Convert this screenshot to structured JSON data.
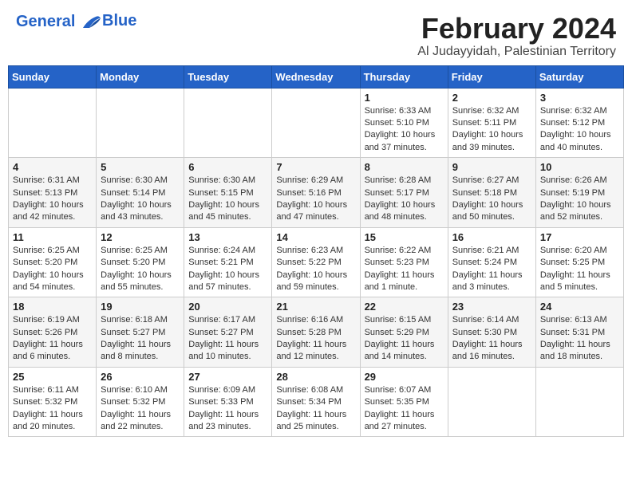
{
  "header": {
    "logo_line1": "General",
    "logo_line2": "Blue",
    "title": "February 2024",
    "subtitle": "Al Judayyidah, Palestinian Territory"
  },
  "days_of_week": [
    "Sunday",
    "Monday",
    "Tuesday",
    "Wednesday",
    "Thursday",
    "Friday",
    "Saturday"
  ],
  "weeks": [
    [
      {
        "day": "",
        "info": ""
      },
      {
        "day": "",
        "info": ""
      },
      {
        "day": "",
        "info": ""
      },
      {
        "day": "",
        "info": ""
      },
      {
        "day": "1",
        "info": "Sunrise: 6:33 AM\nSunset: 5:10 PM\nDaylight: 10 hours\nand 37 minutes."
      },
      {
        "day": "2",
        "info": "Sunrise: 6:32 AM\nSunset: 5:11 PM\nDaylight: 10 hours\nand 39 minutes."
      },
      {
        "day": "3",
        "info": "Sunrise: 6:32 AM\nSunset: 5:12 PM\nDaylight: 10 hours\nand 40 minutes."
      }
    ],
    [
      {
        "day": "4",
        "info": "Sunrise: 6:31 AM\nSunset: 5:13 PM\nDaylight: 10 hours\nand 42 minutes."
      },
      {
        "day": "5",
        "info": "Sunrise: 6:30 AM\nSunset: 5:14 PM\nDaylight: 10 hours\nand 43 minutes."
      },
      {
        "day": "6",
        "info": "Sunrise: 6:30 AM\nSunset: 5:15 PM\nDaylight: 10 hours\nand 45 minutes."
      },
      {
        "day": "7",
        "info": "Sunrise: 6:29 AM\nSunset: 5:16 PM\nDaylight: 10 hours\nand 47 minutes."
      },
      {
        "day": "8",
        "info": "Sunrise: 6:28 AM\nSunset: 5:17 PM\nDaylight: 10 hours\nand 48 minutes."
      },
      {
        "day": "9",
        "info": "Sunrise: 6:27 AM\nSunset: 5:18 PM\nDaylight: 10 hours\nand 50 minutes."
      },
      {
        "day": "10",
        "info": "Sunrise: 6:26 AM\nSunset: 5:19 PM\nDaylight: 10 hours\nand 52 minutes."
      }
    ],
    [
      {
        "day": "11",
        "info": "Sunrise: 6:25 AM\nSunset: 5:20 PM\nDaylight: 10 hours\nand 54 minutes."
      },
      {
        "day": "12",
        "info": "Sunrise: 6:25 AM\nSunset: 5:20 PM\nDaylight: 10 hours\nand 55 minutes."
      },
      {
        "day": "13",
        "info": "Sunrise: 6:24 AM\nSunset: 5:21 PM\nDaylight: 10 hours\nand 57 minutes."
      },
      {
        "day": "14",
        "info": "Sunrise: 6:23 AM\nSunset: 5:22 PM\nDaylight: 10 hours\nand 59 minutes."
      },
      {
        "day": "15",
        "info": "Sunrise: 6:22 AM\nSunset: 5:23 PM\nDaylight: 11 hours\nand 1 minute."
      },
      {
        "day": "16",
        "info": "Sunrise: 6:21 AM\nSunset: 5:24 PM\nDaylight: 11 hours\nand 3 minutes."
      },
      {
        "day": "17",
        "info": "Sunrise: 6:20 AM\nSunset: 5:25 PM\nDaylight: 11 hours\nand 5 minutes."
      }
    ],
    [
      {
        "day": "18",
        "info": "Sunrise: 6:19 AM\nSunset: 5:26 PM\nDaylight: 11 hours\nand 6 minutes."
      },
      {
        "day": "19",
        "info": "Sunrise: 6:18 AM\nSunset: 5:27 PM\nDaylight: 11 hours\nand 8 minutes."
      },
      {
        "day": "20",
        "info": "Sunrise: 6:17 AM\nSunset: 5:27 PM\nDaylight: 11 hours\nand 10 minutes."
      },
      {
        "day": "21",
        "info": "Sunrise: 6:16 AM\nSunset: 5:28 PM\nDaylight: 11 hours\nand 12 minutes."
      },
      {
        "day": "22",
        "info": "Sunrise: 6:15 AM\nSunset: 5:29 PM\nDaylight: 11 hours\nand 14 minutes."
      },
      {
        "day": "23",
        "info": "Sunrise: 6:14 AM\nSunset: 5:30 PM\nDaylight: 11 hours\nand 16 minutes."
      },
      {
        "day": "24",
        "info": "Sunrise: 6:13 AM\nSunset: 5:31 PM\nDaylight: 11 hours\nand 18 minutes."
      }
    ],
    [
      {
        "day": "25",
        "info": "Sunrise: 6:11 AM\nSunset: 5:32 PM\nDaylight: 11 hours\nand 20 minutes."
      },
      {
        "day": "26",
        "info": "Sunrise: 6:10 AM\nSunset: 5:32 PM\nDaylight: 11 hours\nand 22 minutes."
      },
      {
        "day": "27",
        "info": "Sunrise: 6:09 AM\nSunset: 5:33 PM\nDaylight: 11 hours\nand 23 minutes."
      },
      {
        "day": "28",
        "info": "Sunrise: 6:08 AM\nSunset: 5:34 PM\nDaylight: 11 hours\nand 25 minutes."
      },
      {
        "day": "29",
        "info": "Sunrise: 6:07 AM\nSunset: 5:35 PM\nDaylight: 11 hours\nand 27 minutes."
      },
      {
        "day": "",
        "info": ""
      },
      {
        "day": "",
        "info": ""
      }
    ]
  ]
}
